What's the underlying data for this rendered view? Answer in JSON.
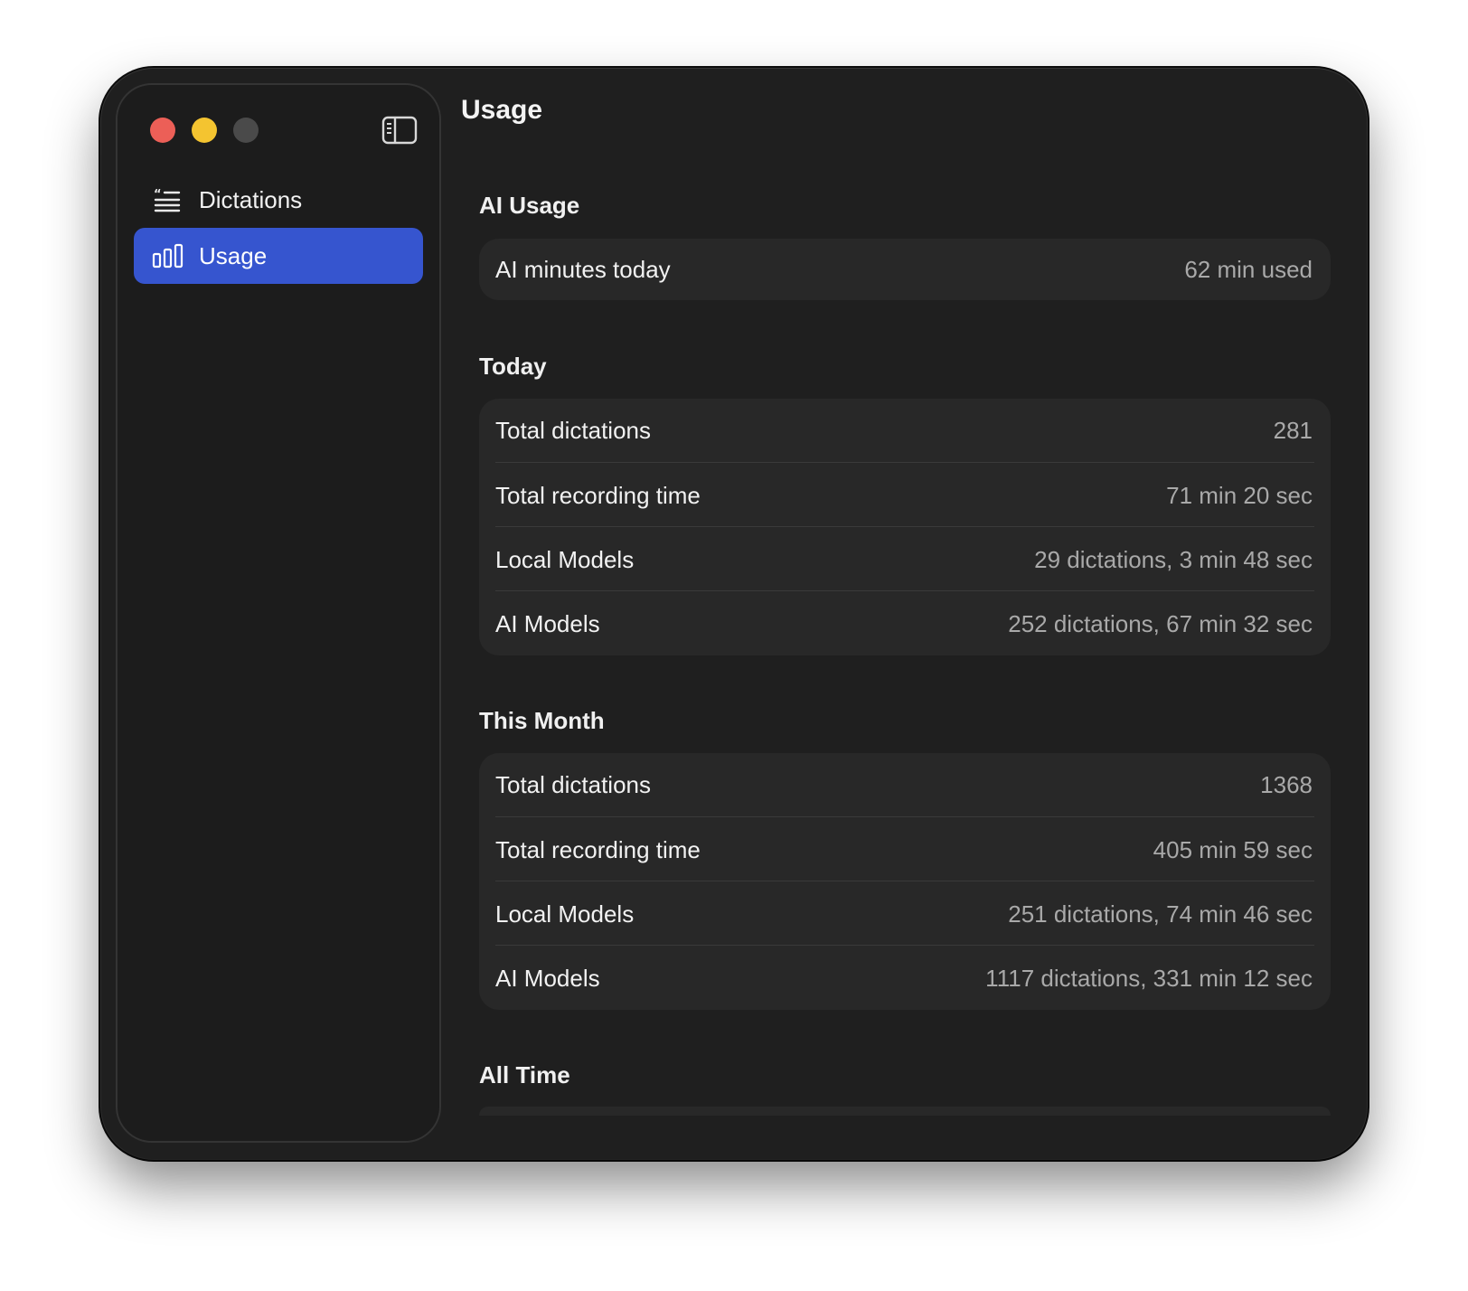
{
  "sidebar": {
    "items": [
      {
        "label": "Dictations",
        "icon": "text-list-icon"
      },
      {
        "label": "Usage",
        "icon": "bar-chart-icon",
        "selected": true
      }
    ]
  },
  "main": {
    "title": "Usage",
    "sections": [
      {
        "title": "AI Usage",
        "rows": [
          {
            "label": "AI minutes today",
            "value": "62 min used"
          }
        ]
      },
      {
        "title": "Today",
        "rows": [
          {
            "label": "Total dictations",
            "value": "281"
          },
          {
            "label": "Total recording time",
            "value": "71 min 20 sec"
          },
          {
            "label": "Local Models",
            "value": "29 dictations, 3 min 48 sec"
          },
          {
            "label": "AI Models",
            "value": "252 dictations, 67 min 32 sec"
          }
        ]
      },
      {
        "title": "This Month",
        "rows": [
          {
            "label": "Total dictations",
            "value": "1368"
          },
          {
            "label": "Total recording time",
            "value": "405 min 59 sec"
          },
          {
            "label": "Local Models",
            "value": "251 dictations, 74 min 46 sec"
          },
          {
            "label": "AI Models",
            "value": "1117 dictations, 331 min 12 sec"
          }
        ]
      },
      {
        "title": "All Time",
        "rows": []
      }
    ]
  },
  "colors": {
    "accent": "#3655cf",
    "window_bg": "#1f1f1f",
    "card_bg": "#282828",
    "close": "#ec5f57",
    "minimize": "#f4c430",
    "zoom_disabled": "#4a4a4a"
  }
}
